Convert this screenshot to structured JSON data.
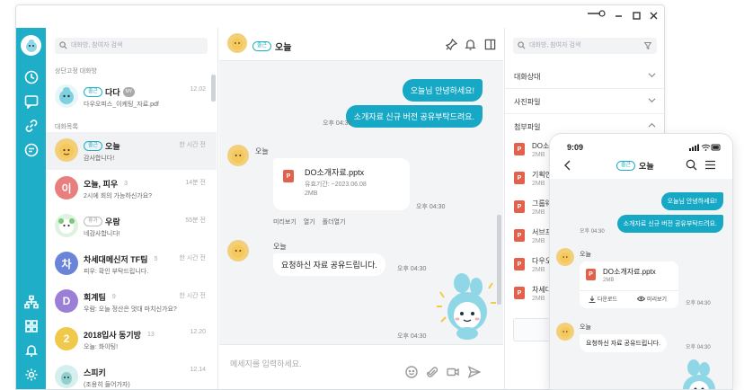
{
  "window_controls": {
    "minimize": "—",
    "restore": "○",
    "maximize": "□",
    "close": "✕"
  },
  "list": {
    "search_placeholder": "대화방, 참여자 검색",
    "pinned_label": "상단고정 대화방",
    "list_label": "대화목록",
    "items": [
      {
        "name": "다다",
        "tag": "출근",
        "pill": "MY",
        "preview": "다우오피스_이케팅_자료.pdf",
        "time": "12.02",
        "color": "#69c8d8"
      },
      {
        "name": "오늘",
        "tag": "출근",
        "preview": "감사합니다!",
        "time": "한 시간 전",
        "color": "#f2b84b"
      },
      {
        "name": "오늘, 피우",
        "count": "3",
        "preview": "2시에 회의 가능하신가요?",
        "time": "14분 전",
        "letter": "이",
        "color": "#e87e7e"
      },
      {
        "name": "우람",
        "tag": "휴가",
        "preview": "네감사합니다!",
        "time": "55분 전",
        "color": "#7ac77a"
      },
      {
        "name": "차세대메신저 TF팀",
        "count": "5",
        "preview": "피우: 확인 부탁드립니다.",
        "time": "한 시간 전",
        "letter": "차",
        "color": "#6a85d8"
      },
      {
        "name": "회계팀",
        "count": "9",
        "preview": "우람: 오늘 정산은 멋대 마치신가요?",
        "time": "한 시간 전",
        "letter": "D",
        "color": "#9b7ed6"
      },
      {
        "name": "2018입사 동기방",
        "count": "13",
        "preview": "오늘: 화이팅!",
        "time": "12.20",
        "letter": "2",
        "color": "#f0c94a"
      },
      {
        "name": "스피키",
        "preview": "(조용히 들어가자)",
        "time": "12.14",
        "color": "#8fd0cf"
      }
    ]
  },
  "chat": {
    "title": "오늘",
    "title_tag": "출근",
    "messages": {
      "me1": "오늘님 안녕하세요!",
      "me2": "소개자료 신규 버전 공유부탁드려요.",
      "me_time": "오후 04:30",
      "sender": "오늘",
      "file_name": "DO소개자료.pptx",
      "file_expiry": "유효기간: ~2023.06.08",
      "file_size": "2MB",
      "file_time": "오후 04:30",
      "file_actions": [
        "미리보기",
        "열기",
        "폴더열기"
      ],
      "sender2": "오늘",
      "them2": "요청하신 자료 공유드립니다.",
      "them2_time": "오후 04:30",
      "sticker_time": "오후 04:30"
    },
    "input_placeholder": "메세지를 입력하세요."
  },
  "right": {
    "search_placeholder": "대화방, 참여자 검색",
    "sections": [
      "대화상대",
      "사진파일",
      "첨부파일"
    ],
    "files": [
      "DO소개",
      "기획안",
      "그룹웨",
      "서브프",
      "다우오",
      "차세대"
    ],
    "file_sub": [
      "2MB",
      "2MB",
      "2MB",
      "2MB",
      "2MB",
      "2MB"
    ]
  },
  "phone": {
    "time": "9:09",
    "title": "오늘",
    "title_tag": "출근",
    "me1": "오늘님 안녕하세요!",
    "me2": "소개자료 신규 버전 공유부탁드려요.",
    "me_time": "오후 04:30",
    "sender": "오늘",
    "file_name": "DO소개자료.pptx",
    "file_size": "2MB",
    "download": "다운로드",
    "preview": "미리보기",
    "file_time": "오후 04:30",
    "sender2": "오늘",
    "them2": "요청하신 자료 공유드립니다.",
    "them2_time": "오후 04:30"
  },
  "colors": {
    "accent": "#1eaec7",
    "bubble": "#17a8c6",
    "ppt": "#e3604b"
  }
}
